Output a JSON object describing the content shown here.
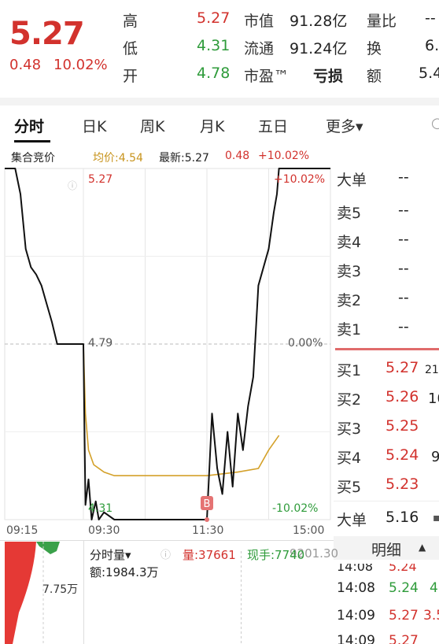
{
  "header": {
    "price": "5.27",
    "change": "0.48",
    "change_pct": "10.02%",
    "rows": [
      {
        "l1": "高",
        "v1": "5.27",
        "l2": "市值",
        "v2": "91.28亿",
        "l3": "量比",
        "v3": "--"
      },
      {
        "l1": "低",
        "v1": "4.31",
        "l2": "流通",
        "v2": "91.24亿",
        "l3": "换",
        "v3": "6."
      },
      {
        "l1": "开",
        "v1": "4.78",
        "l2": "市盈™",
        "v2": "亏损",
        "l3": "额",
        "v3": "5.4"
      }
    ]
  },
  "tabs": [
    "分时",
    "日K",
    "周K",
    "月K",
    "五日",
    "更多▾"
  ],
  "tab_right_icon": "search-icon",
  "info_row": {
    "auction": "集合竞价",
    "avg": "均价:4.54",
    "latest_label": "最新:5.27",
    "change": "0.48",
    "change_pct": "+10.02%"
  },
  "chart_data": {
    "type": "line",
    "y_left_ticks": [
      "5.27",
      "4.79",
      "4.31"
    ],
    "y_right_ticks": [
      "+10.02%",
      "0.00%",
      "-10.02%"
    ],
    "x_ticks": [
      "09:15",
      "09:30",
      "11:30",
      "15:00"
    ],
    "prev_close": 4.79,
    "ylim": [
      4.31,
      5.27
    ],
    "marker": "B",
    "series": [
      {
        "x": [
          "09:15",
          "09:16",
          "09:17",
          "09:18",
          "09:19",
          "09:20",
          "09:21",
          "09:22",
          "09:23",
          "09:24",
          "09:25",
          "09:30",
          "09:32",
          "09:35",
          "09:38",
          "09:42",
          "09:45",
          "09:50",
          "10:00",
          "10:30",
          "11:00",
          "11:30",
          "13:00",
          "13:05",
          "13:10",
          "13:15",
          "13:20",
          "13:25",
          "13:30",
          "13:35",
          "13:40",
          "13:45",
          "13:50",
          "14:00",
          "14:05",
          "14:08",
          "14:10",
          "15:00"
        ],
        "values": [
          5.27,
          5.27,
          5.27,
          5.2,
          5.05,
          5.0,
          4.98,
          4.95,
          4.9,
          4.85,
          4.79,
          4.79,
          4.35,
          4.42,
          4.31,
          4.36,
          4.31,
          4.33,
          4.31,
          4.31,
          4.31,
          4.31,
          4.31,
          4.6,
          4.45,
          4.38,
          4.55,
          4.4,
          4.6,
          4.5,
          4.62,
          4.7,
          4.95,
          5.05,
          5.15,
          5.2,
          5.27,
          5.27
        ]
      },
      {
        "name": "均价",
        "x": [
          "09:30",
          "09:32",
          "09:35",
          "09:40",
          "09:50",
          "10:00",
          "10:30",
          "11:00",
          "11:30",
          "13:00",
          "13:30",
          "13:50",
          "14:00",
          "14:10"
        ],
        "values": [
          4.79,
          4.6,
          4.5,
          4.46,
          4.44,
          4.43,
          4.43,
          4.43,
          4.43,
          4.43,
          4.44,
          4.45,
          4.5,
          4.54
        ]
      }
    ]
  },
  "order_book": {
    "big_order_label": "大单",
    "big_order_val": "--",
    "asks": [
      {
        "label": "卖5",
        "price": "--"
      },
      {
        "label": "卖4",
        "price": "--"
      },
      {
        "label": "卖3",
        "price": "--"
      },
      {
        "label": "卖2",
        "price": "--"
      },
      {
        "label": "卖1",
        "price": "--"
      }
    ],
    "bids": [
      {
        "label": "买1",
        "price": "5.27",
        "vol": "21."
      },
      {
        "label": "买2",
        "price": "5.26",
        "vol": "10"
      },
      {
        "label": "买3",
        "price": "5.25",
        "vol": ""
      },
      {
        "label": "买4",
        "price": "5.24",
        "vol": "9"
      },
      {
        "label": "买5",
        "price": "5.23",
        "vol": ""
      }
    ],
    "big_order_bottom_label": "大单",
    "big_order_bottom_val": "5.16"
  },
  "volume_panel": {
    "selector": "分时量▾",
    "vol": "量:37661",
    "hand": "现手:7740",
    "amount": "额:1984.3万",
    "y_tick": "7.75万",
    "right_tick": "9201.30"
  },
  "detail": {
    "title": "明细",
    "rows": [
      {
        "time": "14:08",
        "price": "5.24",
        "vol": "4"
      },
      {
        "time": "14:09",
        "price": "5.27",
        "vol": "3.5"
      },
      {
        "time": "14:09",
        "price": "5.27",
        "vol": ""
      }
    ],
    "partial_row": {
      "time": "14:08",
      "price": "5.24"
    }
  },
  "colors": {
    "up": "#d2322d",
    "down": "#2e9b3a",
    "avg_line": "#d4a12a",
    "price_line": "#111111"
  }
}
